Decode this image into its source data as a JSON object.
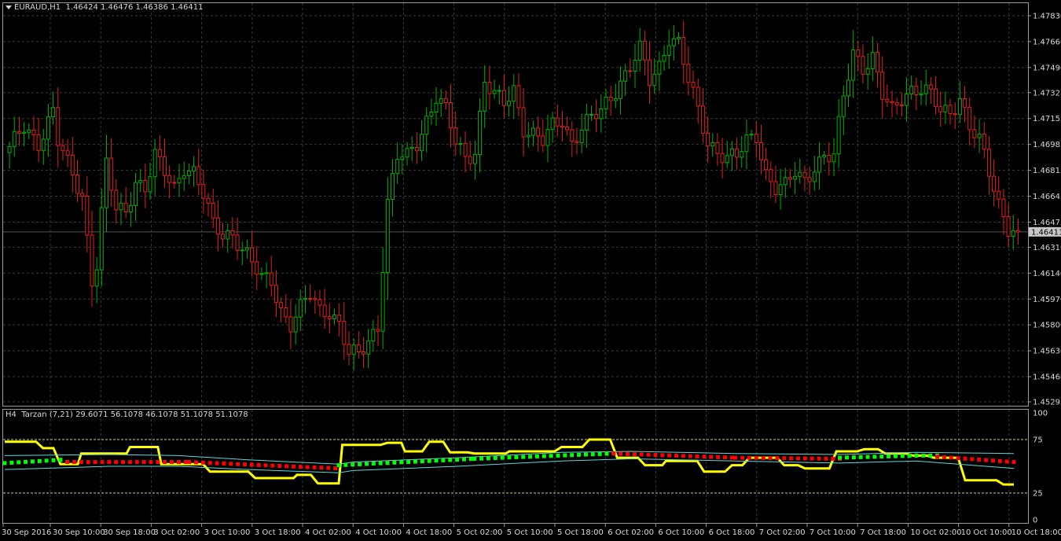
{
  "header": {
    "symbol": "EURAUD,H1",
    "ohlc": "1.46424 1.46476 1.46386 1.46411"
  },
  "indicator_header": {
    "text": "H4  Tarzan (7,21) 29.6071 56.1078 46.1078 51.1078 51.1078"
  },
  "colors": {
    "background": "#000000",
    "bull": "#00b000",
    "bear": "#e02020",
    "grid": "#3a3a3a",
    "axis_text": "#d8d8d8",
    "yellow_line": "#ffff00",
    "band_line": "#5fd7d7",
    "up_marker": "#00ff00",
    "down_marker": "#ff0000"
  },
  "chart_data": [
    {
      "type": "candlestick",
      "title": "EURAUD,H1",
      "ylim": [
        1.45295,
        1.4783
      ],
      "y_ticks": [
        "1.47830",
        "1.47660",
        "1.47490",
        "1.47325",
        "1.47155",
        "1.46985",
        "1.46815",
        "1.46645",
        "1.46475",
        "1.46310",
        "1.46140",
        "1.45970",
        "1.45800",
        "1.45630",
        "1.45460",
        "1.45295"
      ],
      "current_price": "1.46411",
      "x_labels": [
        "30 Sep 2016",
        "30 Sep 10:00",
        "30 Sep 18:00",
        "3 Oct 02:00",
        "3 Oct 10:00",
        "3 Oct 18:00",
        "4 Oct 02:00",
        "4 Oct 10:00",
        "4 Oct 18:00",
        "5 Oct 02:00",
        "5 Oct 10:00",
        "5 Oct 18:00",
        "6 Oct 02:00",
        "6 Oct 10:00",
        "6 Oct 18:00",
        "7 Oct 02:00",
        "7 Oct 10:00",
        "7 Oct 18:00",
        "10 Oct 02:00",
        "10 Oct 10:00",
        "10 Oct 18:00"
      ],
      "anchors": [
        [
          0,
          1.4695
        ],
        [
          3,
          1.471
        ],
        [
          6,
          1.47
        ],
        [
          9,
          1.472
        ],
        [
          10,
          1.47
        ],
        [
          12,
          1.4685
        ],
        [
          15,
          1.4665
        ],
        [
          17,
          1.461
        ],
        [
          18,
          1.462
        ],
        [
          20,
          1.4685
        ],
        [
          22,
          1.4655
        ],
        [
          24,
          1.4655
        ],
        [
          26,
          1.4675
        ],
        [
          28,
          1.467
        ],
        [
          30,
          1.469
        ],
        [
          32,
          1.468
        ],
        [
          34,
          1.467
        ],
        [
          36,
          1.4685
        ],
        [
          38,
          1.468
        ],
        [
          40,
          1.4665
        ],
        [
          42,
          1.4645
        ],
        [
          44,
          1.464
        ],
        [
          46,
          1.464
        ],
        [
          48,
          1.463
        ],
        [
          50,
          1.462
        ],
        [
          52,
          1.461
        ],
        [
          54,
          1.461
        ],
        [
          56,
          1.459
        ],
        [
          58,
          1.458
        ],
        [
          60,
          1.459
        ],
        [
          62,
          1.46
        ],
        [
          64,
          1.459
        ],
        [
          66,
          1.459
        ],
        [
          68,
          1.458
        ],
        [
          70,
          1.456
        ],
        [
          72,
          1.456
        ],
        [
          74,
          1.457
        ],
        [
          76,
          1.458
        ],
        [
          78,
          1.466
        ],
        [
          80,
          1.469
        ],
        [
          82,
          1.469
        ],
        [
          84,
          1.47
        ],
        [
          86,
          1.4715
        ],
        [
          88,
          1.473
        ],
        [
          90,
          1.472
        ],
        [
          92,
          1.47
        ],
        [
          94,
          1.469
        ],
        [
          96,
          1.4695
        ],
        [
          98,
          1.474
        ],
        [
          100,
          1.473
        ],
        [
          102,
          1.4725
        ],
        [
          104,
          1.4735
        ],
        [
          106,
          1.471
        ],
        [
          108,
          1.4705
        ],
        [
          110,
          1.47
        ],
        [
          112,
          1.471
        ],
        [
          114,
          1.4715
        ],
        [
          116,
          1.47
        ],
        [
          118,
          1.471
        ],
        [
          120,
          1.4715
        ],
        [
          122,
          1.472
        ],
        [
          124,
          1.473
        ],
        [
          126,
          1.474
        ],
        [
          128,
          1.475
        ],
        [
          130,
          1.476
        ],
        [
          132,
          1.474
        ],
        [
          134,
          1.475
        ],
        [
          136,
          1.477
        ],
        [
          138,
          1.4765
        ],
        [
          140,
          1.474
        ],
        [
          142,
          1.472
        ],
        [
          144,
          1.47
        ],
        [
          146,
          1.4695
        ],
        [
          148,
          1.469
        ],
        [
          150,
          1.469
        ],
        [
          152,
          1.47
        ],
        [
          154,
          1.4705
        ],
        [
          156,
          1.468
        ],
        [
          158,
          1.467
        ],
        [
          160,
          1.467
        ],
        [
          162,
          1.468
        ],
        [
          164,
          1.4675
        ],
        [
          166,
          1.4685
        ],
        [
          168,
          1.469
        ],
        [
          170,
          1.469
        ],
        [
          172,
          1.473
        ],
        [
          174,
          1.476
        ],
        [
          176,
          1.475
        ],
        [
          178,
          1.4755
        ],
        [
          180,
          1.473
        ],
        [
          182,
          1.472
        ],
        [
          184,
          1.473
        ],
        [
          186,
          1.4735
        ],
        [
          188,
          1.4735
        ],
        [
          190,
          1.473
        ],
        [
          192,
          1.472
        ],
        [
          194,
          1.472
        ],
        [
          196,
          1.473
        ],
        [
          198,
          1.471
        ],
        [
          200,
          1.47
        ],
        [
          202,
          1.468
        ],
        [
          204,
          1.466
        ],
        [
          206,
          1.4645
        ],
        [
          208,
          1.4641
        ]
      ]
    },
    {
      "type": "line",
      "title": "H4  Tarzan (7,21)",
      "ylim": [
        0,
        100
      ],
      "y_ticks": [
        "100",
        "75",
        "25",
        "0"
      ],
      "levels": [
        75,
        25
      ],
      "series": [
        {
          "color": "#ffff00",
          "steps": [
            [
              0,
              73
            ],
            [
              9,
              73
            ],
            [
              11,
              67
            ],
            [
              14,
              67
            ],
            [
              16,
              52
            ],
            [
              21,
              52
            ],
            [
              22,
              62
            ],
            [
              35,
              62
            ],
            [
              36,
              68
            ],
            [
              44,
              68
            ],
            [
              45,
              52
            ],
            [
              57,
              52
            ],
            [
              59,
              45
            ],
            [
              70,
              45
            ],
            [
              72,
              39
            ],
            [
              83,
              39
            ],
            [
              84,
              42
            ],
            [
              88,
              42
            ],
            [
              90,
              34
            ],
            [
              96,
              34
            ],
            [
              97,
              70
            ],
            [
              108,
              70
            ],
            [
              110,
              72
            ],
            [
              114,
              72
            ],
            [
              115,
              64
            ],
            [
              120,
              64
            ],
            [
              122,
              73
            ],
            [
              126,
              73
            ],
            [
              128,
              63
            ],
            [
              133,
              63
            ],
            [
              135,
              62
            ],
            [
              144,
              62
            ],
            [
              145,
              64
            ],
            [
              158,
              64
            ],
            [
              160,
              68
            ],
            [
              166,
              68
            ],
            [
              168,
              75
            ],
            [
              174,
              75
            ],
            [
              176,
              58
            ],
            [
              182,
              58
            ],
            [
              184,
              51
            ],
            [
              189,
              51
            ],
            [
              190,
              55
            ],
            [
              199,
              55
            ],
            [
              201,
              45
            ],
            [
              207,
              45
            ],
            [
              209,
              51
            ],
            [
              212,
              51
            ],
            [
              214,
              58
            ],
            [
              222,
              58
            ],
            [
              224,
              51
            ],
            [
              228,
              51
            ],
            [
              230,
              48
            ],
            [
              237,
              48
            ],
            [
              239,
              64
            ],
            [
              245,
              64
            ],
            [
              247,
              66
            ],
            [
              251,
              66
            ],
            [
              253,
              62
            ],
            [
              259,
              62
            ],
            [
              261,
              60
            ],
            [
              265,
              60
            ],
            [
              267,
              58
            ],
            [
              274,
              58
            ],
            [
              276,
              37
            ],
            [
              285,
              37
            ],
            [
              287,
              33
            ],
            [
              290,
              33
            ]
          ]
        },
        {
          "color": "#5fd7d7",
          "steps": [
            [
              0,
              60
            ],
            [
              30,
              61
            ],
            [
              50,
              60
            ],
            [
              70,
              56
            ],
            [
              96,
              52
            ],
            [
              100,
              54
            ],
            [
              130,
              58
            ],
            [
              160,
              63
            ],
            [
              180,
              64
            ],
            [
              210,
              62
            ],
            [
              240,
              61
            ],
            [
              262,
              63
            ],
            [
              290,
              62
            ]
          ]
        },
        {
          "color": "#5fd7d7",
          "steps": [
            [
              0,
              47
            ],
            [
              30,
              50
            ],
            [
              50,
              50
            ],
            [
              70,
              47
            ],
            [
              96,
              44
            ],
            [
              100,
              46
            ],
            [
              130,
              50
            ],
            [
              160,
              55
            ],
            [
              180,
              57
            ],
            [
              210,
              55
            ],
            [
              240,
              53
            ],
            [
              262,
              55
            ],
            [
              290,
              48
            ]
          ]
        },
        {
          "color": "#00ff00",
          "steps": [
            [
              0,
              53
            ],
            [
              16,
              56
            ],
            [
              18,
              54
            ]
          ]
        },
        {
          "color": "#ff0000",
          "steps": [
            [
              18,
              54
            ],
            [
              53,
              54
            ],
            [
              96,
              48
            ]
          ]
        },
        {
          "color": "#00ff00",
          "steps": [
            [
              96,
              51
            ],
            [
              135,
              57
            ],
            [
              175,
              62
            ]
          ]
        },
        {
          "color": "#ff0000",
          "steps": [
            [
              175,
              62
            ],
            [
              210,
              58
            ],
            [
              240,
              57
            ]
          ]
        },
        {
          "color": "#00ff00",
          "steps": [
            [
              240,
              58
            ],
            [
              262,
              60
            ],
            [
              268,
              60
            ]
          ]
        },
        {
          "color": "#ff0000",
          "steps": [
            [
              268,
              59
            ],
            [
              290,
              54
            ]
          ]
        }
      ]
    }
  ]
}
